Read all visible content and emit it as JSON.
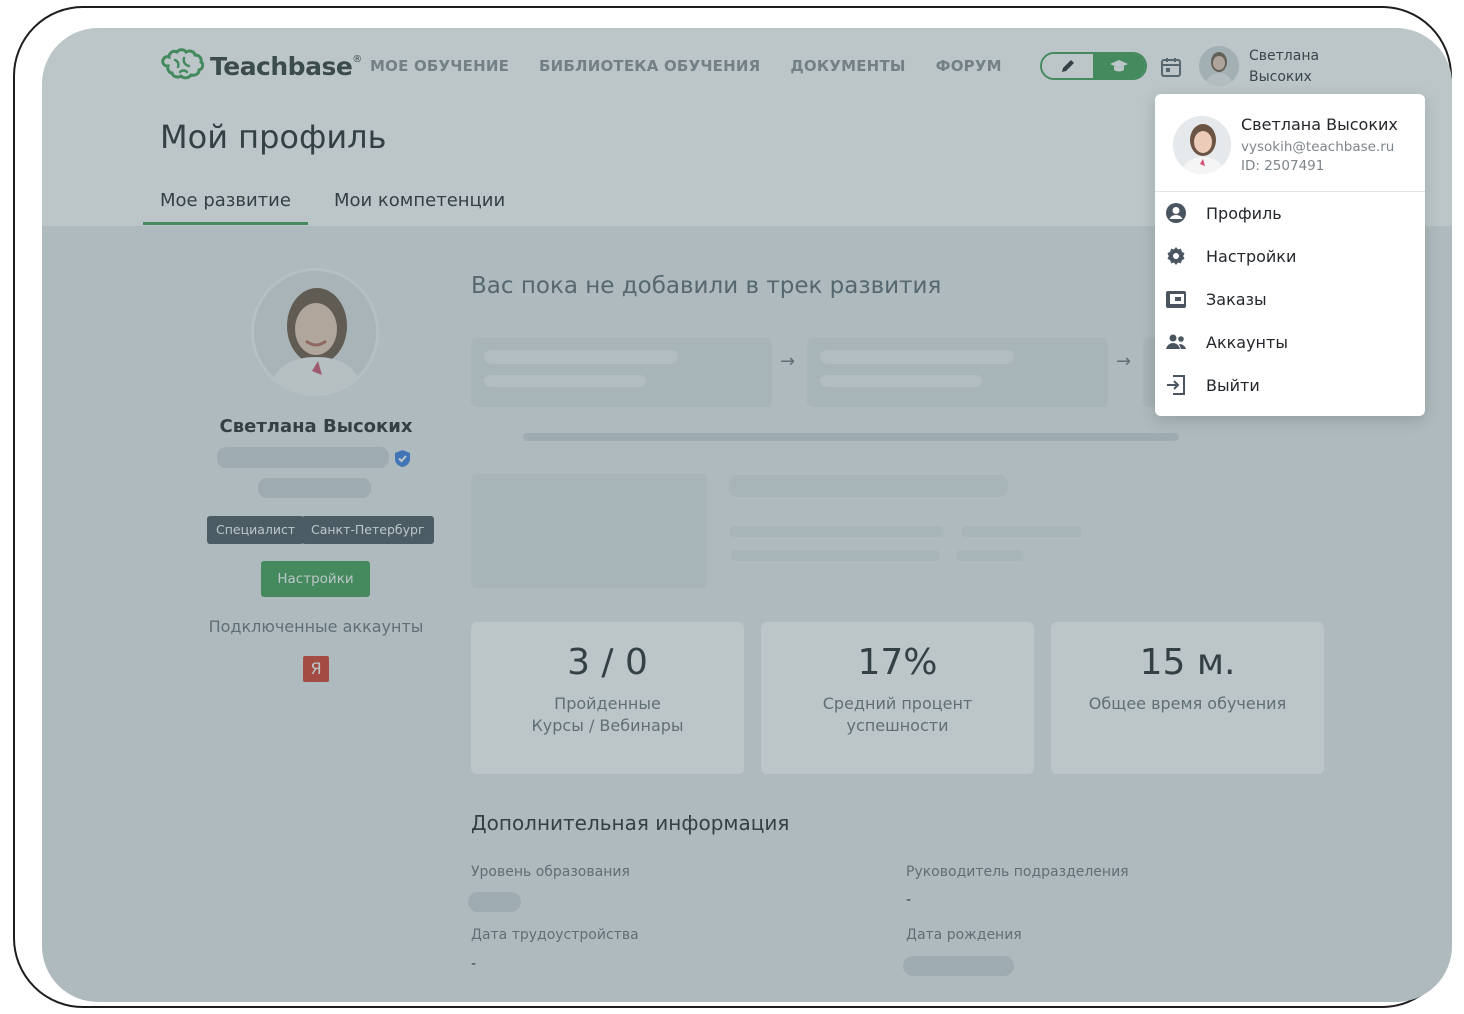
{
  "app": {
    "logo_text": "Teachbase",
    "logo_mark": "®"
  },
  "nav": {
    "items": [
      {
        "label": "МОЕ ОБУЧЕНИЕ"
      },
      {
        "label": "БИБЛИОТЕКА ОБУЧЕНИЯ"
      },
      {
        "label": "ДОКУМЕНТЫ"
      },
      {
        "label": "ФОРУМ"
      }
    ]
  },
  "header": {
    "user_first": "Светлана",
    "user_last": "Высоких",
    "icons": [
      "pencil-icon",
      "graduation-cap-icon",
      "calendar-icon"
    ]
  },
  "page": {
    "title": "Мой профиль",
    "tabs": [
      {
        "label": "Мое развитие",
        "active": true
      },
      {
        "label": "Мои компетенции",
        "active": false
      }
    ]
  },
  "profile": {
    "name": "Светлана Высоких",
    "badges": [
      "Специалист",
      "Санкт-Петербург"
    ],
    "settings_button": "Настройки",
    "connected_label": "Подключенные аккаунты",
    "yandex_letter": "Я"
  },
  "track": {
    "empty_title": "Вас пока не добавили в трек развития",
    "arrow": "→"
  },
  "stats": [
    {
      "value": "3 / 0",
      "label_line1": "Пройденные",
      "label_line2": "Курсы / Вебинары"
    },
    {
      "value": "17%",
      "label_line1": "Средний процент",
      "label_line2": "успешности"
    },
    {
      "value": "15 м.",
      "label_line1": "Общее время обучения",
      "label_line2": ""
    }
  ],
  "extra": {
    "title": "Дополнительная информация",
    "fields": {
      "education_label": "Уровень образования",
      "manager_label": "Руководитель подразделения",
      "manager_value": "-",
      "hire_date_label": "Дата трудоустройства",
      "hire_date_value": "-",
      "birth_date_label": "Дата рождения"
    }
  },
  "dropdown": {
    "name": "Светлана Высоких",
    "email": "vysokih@teachbase.ru",
    "id": "ID: 2507491",
    "items": [
      {
        "label": "Профиль",
        "icon": "user-circle-icon"
      },
      {
        "label": "Настройки",
        "icon": "gear-icon"
      },
      {
        "label": "Заказы",
        "icon": "wallet-icon"
      },
      {
        "label": "Аккаунты",
        "icon": "users-icon"
      },
      {
        "label": "Выйти",
        "icon": "logout-icon"
      }
    ]
  },
  "colors": {
    "accent": "#3f9d55",
    "badge_bg": "#4a5560",
    "overlay": "rgba(78,104,110,0.38)",
    "yandex": "#d93a2b",
    "verified": "#3b7de0"
  }
}
